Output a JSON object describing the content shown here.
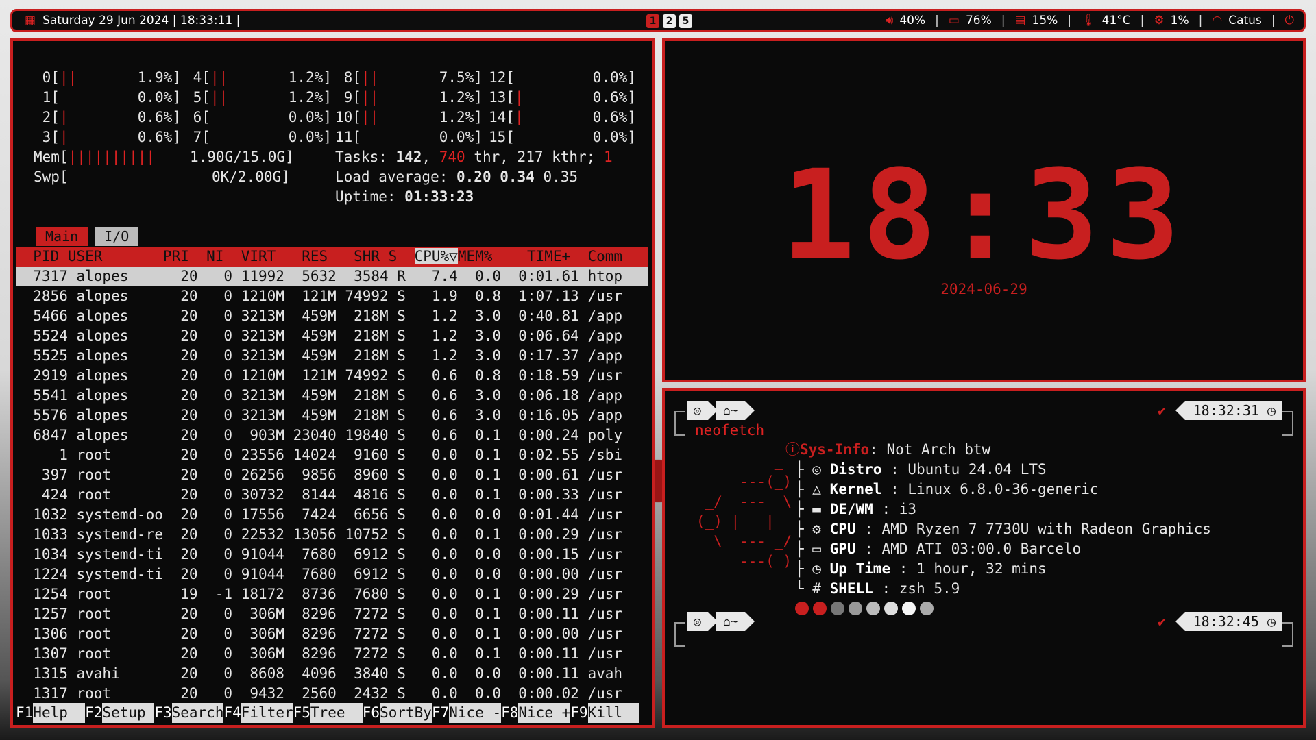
{
  "topbar": {
    "date": "Saturday  29 Jun 2024 | 18:33:11 |",
    "workspaces": [
      "1",
      "2",
      "5"
    ],
    "active_workspace": "1",
    "volume": "40%",
    "battery": "76%",
    "memory": "15%",
    "temperature": "41°C",
    "cpu": "1%",
    "wifi": "Catus",
    "separator": "|"
  },
  "htop": {
    "cpus": [
      {
        "id": "0",
        "bars": "||",
        "val": "1.9%]"
      },
      {
        "id": "1",
        "bars": "",
        "val": "0.0%]"
      },
      {
        "id": "2",
        "bars": "|",
        "val": "0.6%]"
      },
      {
        "id": "3",
        "bars": "|",
        "val": "0.6%]"
      },
      {
        "id": "4",
        "bars": "||",
        "val": "1.2%]"
      },
      {
        "id": "5",
        "bars": "||",
        "val": "1.2%]"
      },
      {
        "id": "6",
        "bars": "",
        "val": "0.0%]"
      },
      {
        "id": "7",
        "bars": "",
        "val": "0.0%]"
      },
      {
        "id": "8",
        "bars": "||",
        "val": "7.5%]"
      },
      {
        "id": "9",
        "bars": "||",
        "val": "1.2%]"
      },
      {
        "id": "10",
        "bars": "||",
        "val": "1.2%]"
      },
      {
        "id": "11",
        "bars": "",
        "val": "0.0%]"
      },
      {
        "id": "12",
        "bars": "",
        "val": "0.0%]"
      },
      {
        "id": "13",
        "bars": "|",
        "val": "0.6%]"
      },
      {
        "id": "14",
        "bars": "|",
        "val": "0.6%]"
      },
      {
        "id": "15",
        "bars": "",
        "val": "0.0%]"
      }
    ],
    "mem_label": "Mem[",
    "mem_bars": "||||||||||",
    "mem_value": "1.90G/15.0G]",
    "swp_label": "Swp[",
    "swp_value": "0K/2.00G]",
    "tasks_label": "Tasks: ",
    "tasks": "142",
    "threads": "740",
    "thr_text": " thr, 217 kthr; ",
    "running": "1",
    "load_label": "Load average: ",
    "load1": "0.20",
    "load5": "0.34",
    "load15": "0.35",
    "uptime_label": "Uptime: ",
    "uptime": "01:33:23",
    "tab_main": "Main",
    "tab_io": "I/O",
    "header_pre": "  PID USER       PRI  NI  VIRT   RES   SHR S  ",
    "header_sort": "CPU%▽",
    "header_post": "MEM%    TIME+  Comm",
    "processes": [
      "  7317 alopes      20   0 11992  5632  3584 R   7.4  0.0  0:01.61 htop",
      "  2856 alopes      20   0 1210M  121M 74992 S   1.9  0.8  1:07.13 /usr",
      "  5466 alopes      20   0 3213M  459M  218M S   1.2  3.0  0:40.81 /app",
      "  5524 alopes      20   0 3213M  459M  218M S   1.2  3.0  0:06.64 /app",
      "  5525 alopes      20   0 3213M  459M  218M S   1.2  3.0  0:17.37 /app",
      "  2919 alopes      20   0 1210M  121M 74992 S   0.6  0.8  0:18.59 /usr",
      "  5541 alopes      20   0 3213M  459M  218M S   0.6  3.0  0:06.18 /app",
      "  5576 alopes      20   0 3213M  459M  218M S   0.6  3.0  0:16.05 /app",
      "  6847 alopes      20   0  903M 23040 19840 S   0.6  0.1  0:00.24 poly",
      "     1 root        20   0 23556 14024  9160 S   0.0  0.1  0:02.55 /sbi",
      "   397 root        20   0 26256  9856  8960 S   0.0  0.1  0:00.61 /usr",
      "   424 root        20   0 30732  8144  4816 S   0.0  0.1  0:00.33 /usr",
      "  1032 systemd-oo  20   0 17556  7424  6656 S   0.0  0.0  0:01.44 /usr",
      "  1033 systemd-re  20   0 22532 13056 10752 S   0.0  0.1  0:00.29 /usr",
      "  1034 systemd-ti  20   0 91044  7680  6912 S   0.0  0.0  0:00.15 /usr",
      "  1224 systemd-ti  20   0 91044  7680  6912 S   0.0  0.0  0:00.00 /usr",
      "  1254 root        19  -1 18172  8736  7680 S   0.0  0.1  0:00.29 /usr",
      "  1257 root        20   0  306M  8296  7272 S   0.0  0.1  0:00.11 /usr",
      "  1306 root        20   0  306M  8296  7272 S   0.0  0.1  0:00.00 /usr",
      "  1307 root        20   0  306M  8296  7272 S   0.0  0.1  0:00.11 /usr",
      "  1315 avahi       20   0  8608  4096  3840 S   0.0  0.0  0:00.11 avah",
      "  1317 root        20   0  9432  2560  2432 S   0.0  0.0  0:00.02 /usr"
    ],
    "fkeys": [
      {
        "k": "F1",
        "l": "Help  "
      },
      {
        "k": "F2",
        "l": "Setup "
      },
      {
        "k": "F3",
        "l": "Search"
      },
      {
        "k": "F4",
        "l": "Filter"
      },
      {
        "k": "F5",
        "l": "Tree  "
      },
      {
        "k": "F6",
        "l": "SortBy"
      },
      {
        "k": "F7",
        "l": "Nice -"
      },
      {
        "k": "F8",
        "l": "Nice +"
      },
      {
        "k": "F9",
        "l": "Kill  "
      }
    ]
  },
  "clock": {
    "time": "18:33",
    "date": "2024-06-29"
  },
  "terminal": {
    "prompt_dir": "~",
    "command": "neofetch",
    "time1": "18:32:31",
    "time2": "18:32:45",
    "check": "✔",
    "sysinfo_label": "Sys-Info",
    "sysinfo_value": ": Not Arch btw",
    "rows": [
      {
        "label": "Distro",
        "value": " : Ubuntu 24.04 LTS",
        "icon": "ubuntu-icon"
      },
      {
        "label": "Kernel",
        "value": " : Linux 6.8.0-36-generic",
        "icon": "linux-icon"
      },
      {
        "label": "DE/WM",
        "value": " : i3",
        "icon": "window-icon"
      },
      {
        "label": "CPU",
        "value": " : AMD Ryzen 7 7730U with Radeon Graphics",
        "icon": "cpu-icon"
      },
      {
        "label": "GPU",
        "value": " : AMD ATI 03:00.0 Barcelo",
        "icon": "monitor-icon"
      },
      {
        "label": "Up Time",
        "value": " : 1 hour, 32 mins",
        "icon": "clock-icon"
      },
      {
        "label": "SHELL",
        "value": " : zsh 5.9",
        "icon": "hash-icon"
      }
    ],
    "logo": "            _\n        ---(_)\n    _/  ---  \\\n   (_) |   |\n     \\  --- _/\n        ---(_)",
    "palette": [
      "#c81f1f",
      "#c81f1f",
      "#777777",
      "#999999",
      "#bbbbbb",
      "#dddddd",
      "#f5f5f5",
      "#aaaaaa"
    ]
  }
}
